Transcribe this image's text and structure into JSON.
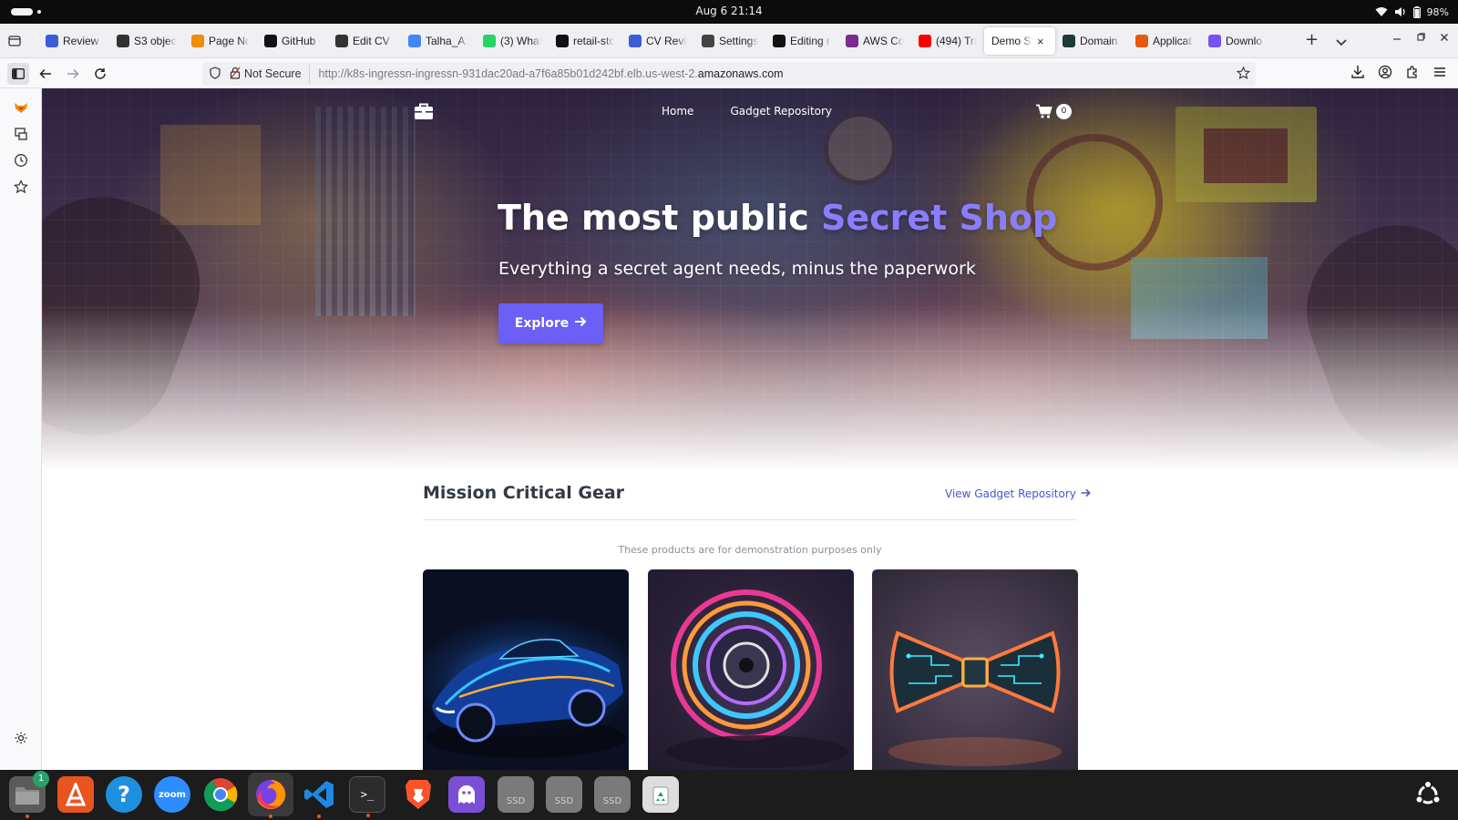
{
  "system_bar": {
    "clock": "Aug 6  21:14",
    "battery": "98%"
  },
  "browser": {
    "tabs": [
      {
        "label": "Review f",
        "icon": "review-favicon",
        "color": "#3b5bdb"
      },
      {
        "label": "S3 objec",
        "icon": "s3-favicon",
        "color": "#333333"
      },
      {
        "label": "Page No",
        "icon": "page-favicon",
        "color": "#f08c00"
      },
      {
        "label": "GitHub -",
        "icon": "github-favicon",
        "color": "#111111"
      },
      {
        "label": "Edit CV |",
        "icon": "edit-favicon",
        "color": "#333333"
      },
      {
        "label": "Talha_A:",
        "icon": "docs-favicon",
        "color": "#4285f4"
      },
      {
        "label": "(3) What",
        "icon": "whatsapp-favicon",
        "color": "#25d366"
      },
      {
        "label": "retail-stc",
        "icon": "github-favicon",
        "color": "#111111"
      },
      {
        "label": "CV Revie",
        "icon": "cv-favicon",
        "color": "#3b5bdb"
      },
      {
        "label": "Settings",
        "icon": "gear-icon",
        "color": "#444444"
      },
      {
        "label": "Editing r",
        "icon": "github-favicon",
        "color": "#111111"
      },
      {
        "label": "AWS Co",
        "icon": "aws-favicon",
        "color": "#7a2d8f"
      },
      {
        "label": "(494) Tra",
        "icon": "youtube-favicon",
        "color": "#ff0000"
      },
      {
        "label": "Demo Stc",
        "icon": "",
        "color": "",
        "active": true
      },
      {
        "label": "Domain",
        "icon": "domain-favicon",
        "color": "#1e3a3a"
      },
      {
        "label": "Applicat",
        "icon": "app-favicon",
        "color": "#e8590c"
      },
      {
        "label": "Downlo",
        "icon": "download-favicon",
        "color": "#7950f2"
      }
    ],
    "url_security_label": "Not Secure",
    "url_prefix": "http://k8s-ingressn-ingressn-931dac20ad-a7f6a85b01d242bf.elb.us-west-2.",
    "url_domain": "amazonaws.com"
  },
  "site": {
    "nav": {
      "home": "Home",
      "gadgets": "Gadget Repository",
      "cart_count": "0"
    },
    "hero": {
      "title_plain": "The most public ",
      "title_highlight": "Secret Shop",
      "subtitle": "Everything a secret agent needs, minus the paperwork",
      "cta": "Explore"
    },
    "gear": {
      "title": "Mission Critical Gear",
      "link": "View Gadget Repository",
      "note": "These products are for demonstration purposes only",
      "products": [
        {
          "image": "neon-sports-car"
        },
        {
          "image": "neon-gadget-disc"
        },
        {
          "image": "neon-circuit-bowtie"
        }
      ]
    },
    "colors": {
      "accent": "#6b5ff5",
      "highlight": "#8a7dff",
      "link": "#4a57c8"
    }
  },
  "dock": {
    "apps": [
      "files",
      "app-center",
      "help",
      "zoom",
      "chrome",
      "firefox",
      "vscode",
      "terminal",
      "brave",
      "ghost-app",
      "ssd-drive",
      "ssd-drive",
      "ssd-drive",
      "trash",
      "show-apps"
    ],
    "files_badge": "1",
    "zoom_label": "zoom",
    "ssd_label": "SSD"
  }
}
